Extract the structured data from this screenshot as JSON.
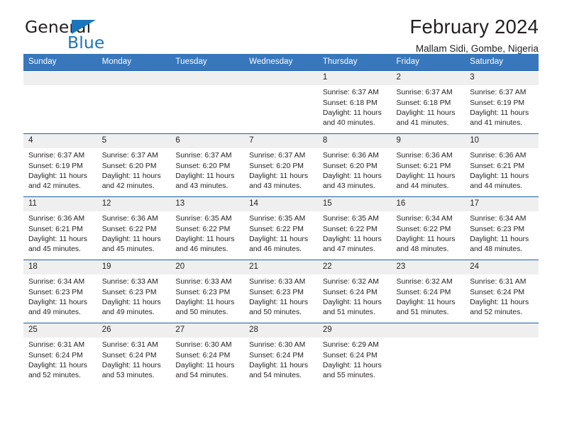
{
  "brand": {
    "name_part1": "General",
    "name_part2": "Blue",
    "accent_color": "#1b75bb"
  },
  "header": {
    "month_title": "February 2024",
    "location": "Mallam Sidi, Gombe, Nigeria"
  },
  "theme": {
    "header_bg": "#3877bc",
    "row_divider": "#1b5fa8",
    "daynum_bg": "#efefef",
    "text": "#231f20"
  },
  "weekday_headers": [
    "Sunday",
    "Monday",
    "Tuesday",
    "Wednesday",
    "Thursday",
    "Friday",
    "Saturday"
  ],
  "weeks": [
    [
      {
        "day": "",
        "lines": []
      },
      {
        "day": "",
        "lines": []
      },
      {
        "day": "",
        "lines": []
      },
      {
        "day": "",
        "lines": []
      },
      {
        "day": "1",
        "lines": [
          "Sunrise: 6:37 AM",
          "Sunset: 6:18 PM",
          "Daylight: 11 hours",
          "and 40 minutes."
        ]
      },
      {
        "day": "2",
        "lines": [
          "Sunrise: 6:37 AM",
          "Sunset: 6:18 PM",
          "Daylight: 11 hours",
          "and 41 minutes."
        ]
      },
      {
        "day": "3",
        "lines": [
          "Sunrise: 6:37 AM",
          "Sunset: 6:19 PM",
          "Daylight: 11 hours",
          "and 41 minutes."
        ]
      }
    ],
    [
      {
        "day": "4",
        "lines": [
          "Sunrise: 6:37 AM",
          "Sunset: 6:19 PM",
          "Daylight: 11 hours",
          "and 42 minutes."
        ]
      },
      {
        "day": "5",
        "lines": [
          "Sunrise: 6:37 AM",
          "Sunset: 6:20 PM",
          "Daylight: 11 hours",
          "and 42 minutes."
        ]
      },
      {
        "day": "6",
        "lines": [
          "Sunrise: 6:37 AM",
          "Sunset: 6:20 PM",
          "Daylight: 11 hours",
          "and 43 minutes."
        ]
      },
      {
        "day": "7",
        "lines": [
          "Sunrise: 6:37 AM",
          "Sunset: 6:20 PM",
          "Daylight: 11 hours",
          "and 43 minutes."
        ]
      },
      {
        "day": "8",
        "lines": [
          "Sunrise: 6:36 AM",
          "Sunset: 6:20 PM",
          "Daylight: 11 hours",
          "and 43 minutes."
        ]
      },
      {
        "day": "9",
        "lines": [
          "Sunrise: 6:36 AM",
          "Sunset: 6:21 PM",
          "Daylight: 11 hours",
          "and 44 minutes."
        ]
      },
      {
        "day": "10",
        "lines": [
          "Sunrise: 6:36 AM",
          "Sunset: 6:21 PM",
          "Daylight: 11 hours",
          "and 44 minutes."
        ]
      }
    ],
    [
      {
        "day": "11",
        "lines": [
          "Sunrise: 6:36 AM",
          "Sunset: 6:21 PM",
          "Daylight: 11 hours",
          "and 45 minutes."
        ]
      },
      {
        "day": "12",
        "lines": [
          "Sunrise: 6:36 AM",
          "Sunset: 6:22 PM",
          "Daylight: 11 hours",
          "and 45 minutes."
        ]
      },
      {
        "day": "13",
        "lines": [
          "Sunrise: 6:35 AM",
          "Sunset: 6:22 PM",
          "Daylight: 11 hours",
          "and 46 minutes."
        ]
      },
      {
        "day": "14",
        "lines": [
          "Sunrise: 6:35 AM",
          "Sunset: 6:22 PM",
          "Daylight: 11 hours",
          "and 46 minutes."
        ]
      },
      {
        "day": "15",
        "lines": [
          "Sunrise: 6:35 AM",
          "Sunset: 6:22 PM",
          "Daylight: 11 hours",
          "and 47 minutes."
        ]
      },
      {
        "day": "16",
        "lines": [
          "Sunrise: 6:34 AM",
          "Sunset: 6:22 PM",
          "Daylight: 11 hours",
          "and 48 minutes."
        ]
      },
      {
        "day": "17",
        "lines": [
          "Sunrise: 6:34 AM",
          "Sunset: 6:23 PM",
          "Daylight: 11 hours",
          "and 48 minutes."
        ]
      }
    ],
    [
      {
        "day": "18",
        "lines": [
          "Sunrise: 6:34 AM",
          "Sunset: 6:23 PM",
          "Daylight: 11 hours",
          "and 49 minutes."
        ]
      },
      {
        "day": "19",
        "lines": [
          "Sunrise: 6:33 AM",
          "Sunset: 6:23 PM",
          "Daylight: 11 hours",
          "and 49 minutes."
        ]
      },
      {
        "day": "20",
        "lines": [
          "Sunrise: 6:33 AM",
          "Sunset: 6:23 PM",
          "Daylight: 11 hours",
          "and 50 minutes."
        ]
      },
      {
        "day": "21",
        "lines": [
          "Sunrise: 6:33 AM",
          "Sunset: 6:23 PM",
          "Daylight: 11 hours",
          "and 50 minutes."
        ]
      },
      {
        "day": "22",
        "lines": [
          "Sunrise: 6:32 AM",
          "Sunset: 6:24 PM",
          "Daylight: 11 hours",
          "and 51 minutes."
        ]
      },
      {
        "day": "23",
        "lines": [
          "Sunrise: 6:32 AM",
          "Sunset: 6:24 PM",
          "Daylight: 11 hours",
          "and 51 minutes."
        ]
      },
      {
        "day": "24",
        "lines": [
          "Sunrise: 6:31 AM",
          "Sunset: 6:24 PM",
          "Daylight: 11 hours",
          "and 52 minutes."
        ]
      }
    ],
    [
      {
        "day": "25",
        "lines": [
          "Sunrise: 6:31 AM",
          "Sunset: 6:24 PM",
          "Daylight: 11 hours",
          "and 52 minutes."
        ]
      },
      {
        "day": "26",
        "lines": [
          "Sunrise: 6:31 AM",
          "Sunset: 6:24 PM",
          "Daylight: 11 hours",
          "and 53 minutes."
        ]
      },
      {
        "day": "27",
        "lines": [
          "Sunrise: 6:30 AM",
          "Sunset: 6:24 PM",
          "Daylight: 11 hours",
          "and 54 minutes."
        ]
      },
      {
        "day": "28",
        "lines": [
          "Sunrise: 6:30 AM",
          "Sunset: 6:24 PM",
          "Daylight: 11 hours",
          "and 54 minutes."
        ]
      },
      {
        "day": "29",
        "lines": [
          "Sunrise: 6:29 AM",
          "Sunset: 6:24 PM",
          "Daylight: 11 hours",
          "and 55 minutes."
        ]
      },
      {
        "day": "",
        "lines": []
      },
      {
        "day": "",
        "lines": []
      }
    ]
  ]
}
